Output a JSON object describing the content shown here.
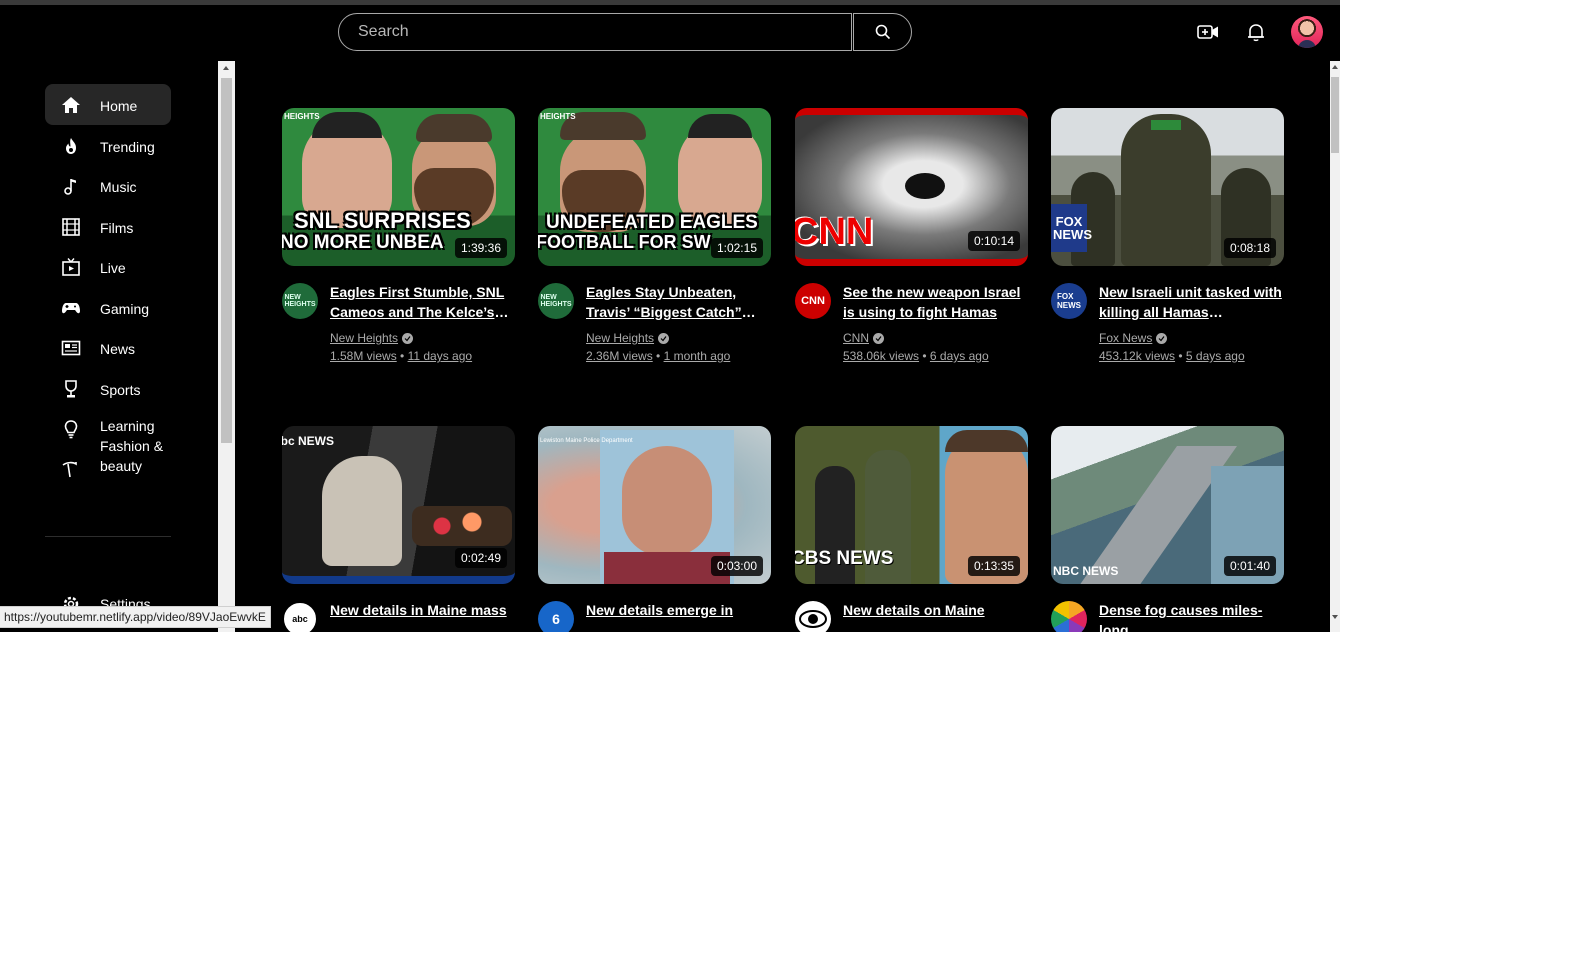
{
  "header": {
    "search_placeholder": "Search",
    "icons": [
      "search-icon",
      "create-video-icon",
      "notifications-bell-icon",
      "user-avatar"
    ]
  },
  "sidebar": {
    "items": [
      {
        "label": "Home",
        "icon": "home-icon",
        "active": true
      },
      {
        "label": "Trending",
        "icon": "flame-icon"
      },
      {
        "label": "Music",
        "icon": "music-note-icon"
      },
      {
        "label": "Films",
        "icon": "film-icon"
      },
      {
        "label": "Live",
        "icon": "live-tv-icon"
      },
      {
        "label": "Gaming",
        "icon": "gamepad-icon"
      },
      {
        "label": "News",
        "icon": "newspaper-icon"
      },
      {
        "label": "Sports",
        "icon": "trophy-icon"
      },
      {
        "label": "Learning",
        "icon": "lightbulb-icon"
      },
      {
        "label": "Fashion & beauty",
        "icon": "hanger-icon"
      }
    ],
    "settings_label": "Settings"
  },
  "videos": [
    {
      "title": "Eagles First Stumble, SNL Cameos and The Kelce’s R…",
      "channel": "New Heights",
      "views": "1.58M views",
      "age": "11 days ago",
      "duration": "1:39:36",
      "thumb_text": [
        "SNL SURPRISES",
        "NO MORE UNBEA"
      ],
      "thumb_brand": "HEIGHTS"
    },
    {
      "title": "Eagles Stay Unbeaten, Travis’ “Biggest Catch” an…",
      "channel": "New Heights",
      "views": "2.36M views",
      "age": "1 month ago",
      "duration": "1:02:15",
      "thumb_text": [
        "UNDEFEATED EAGLES",
        "FOOTBALL FOR SW"
      ],
      "thumb_brand": "HEIGHTS"
    },
    {
      "title": "See the new weapon Israel is using to fight Hamas",
      "channel": "CNN",
      "views": "538.06k views",
      "age": "6 days ago",
      "duration": "0:10:14",
      "thumb_brand": "CNN"
    },
    {
      "title": "New Israeli unit tasked with killing all Hamas terrorists…",
      "channel": "Fox News",
      "views": "453.12k views",
      "age": "5 days ago",
      "duration": "0:08:18",
      "thumb_brand": "FOX NEWS"
    },
    {
      "title": "New details in Maine mass",
      "duration": "0:02:49",
      "thumb_brand": "abc NEWS"
    },
    {
      "title": "New details emerge in",
      "duration": "0:03:00",
      "thumb_brand": "Lewiston Maine Police Department"
    },
    {
      "title": "New details on Maine",
      "duration": "0:13:35",
      "thumb_brand": "CBS NEWS"
    },
    {
      "title": "Dense fog causes miles-long",
      "duration": "0:01:40",
      "thumb_brand": "NBC NEWS"
    }
  ],
  "status_bar_url": "https://youtubemr.netlify.app/video/89VJaoEwvkE",
  "colors": {
    "background": "#000000",
    "active_item": "#272727",
    "cnn_red": "#cc0000"
  }
}
